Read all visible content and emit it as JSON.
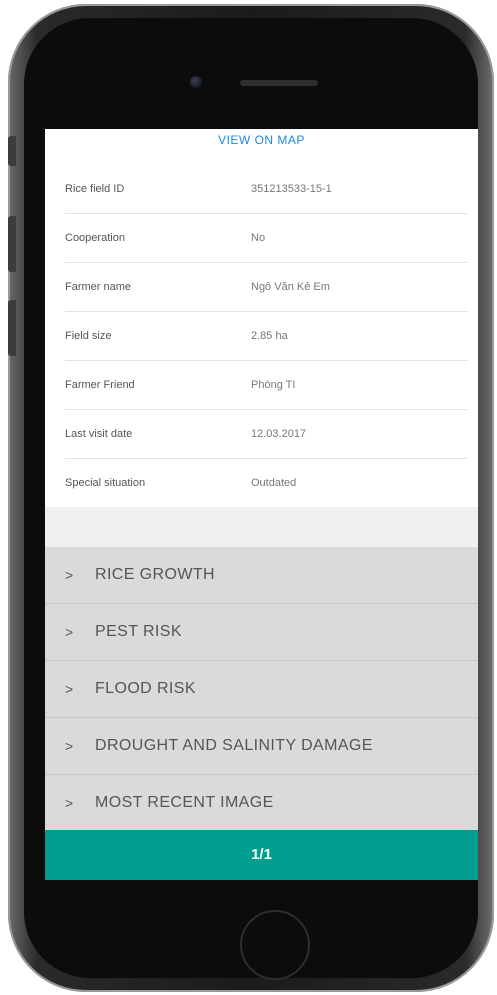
{
  "screen": {
    "map_link": "VIEW ON MAP",
    "info_rows": [
      {
        "label": "Rice field ID",
        "value": "351213533-15-1"
      },
      {
        "label": "Cooperation",
        "value": "No"
      },
      {
        "label": "Farmer name",
        "value": "Ngô Văn Kẻ Em"
      },
      {
        "label": "Field size",
        "value": "2.85 ha"
      },
      {
        "label": "Farmer Friend",
        "value": "Phòng TI"
      },
      {
        "label": "Last visit date",
        "value": "12.03.2017"
      },
      {
        "label": "Special situation",
        "value": "Outdated"
      }
    ],
    "sections": [
      {
        "label": "RICE GROWTH"
      },
      {
        "label": "PEST RISK"
      },
      {
        "label": "FLOOD RISK"
      },
      {
        "label": "DROUGHT AND SALINITY DAMAGE"
      },
      {
        "label": "MOST RECENT IMAGE"
      }
    ],
    "chevron_glyph": ">",
    "pager_text": "1/1"
  },
  "colors": {
    "link": "#1e88e5",
    "pager_bg": "#009e8e",
    "section_bg": "#dadada"
  },
  "icons": [
    "chevron-right-icon"
  ]
}
